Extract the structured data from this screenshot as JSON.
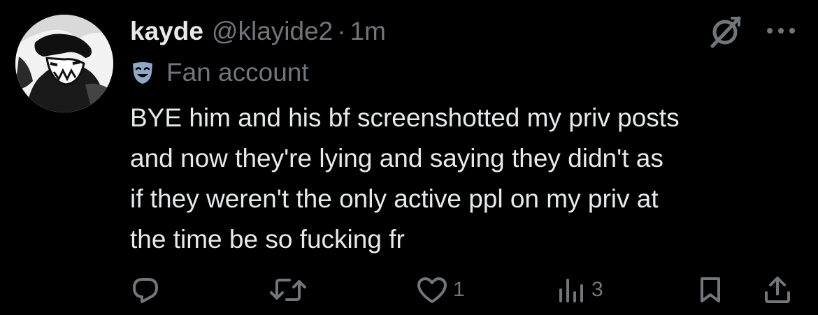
{
  "tweet": {
    "display_name": "kayde",
    "handle": "@klayide2",
    "separator": "·",
    "time": "1m",
    "label": "Fan account",
    "label_icon": "theater-mask-icon",
    "body_lines": [
      "BYE him and his bf screenshotted my priv posts",
      "and now they're lying and saying they didn't as",
      "if they weren't the only active ppl on my priv at",
      "the time be so fucking fr"
    ]
  },
  "actions": {
    "reply_count": "",
    "retweet_count": "",
    "like_count": "1",
    "view_count": "3"
  },
  "colors": {
    "background": "#000000",
    "primary_text": "#e7e9ea",
    "secondary_text": "#71767b",
    "badge_icon": "#8fa8c8"
  },
  "icons": {
    "grok": "grok-icon",
    "more": "more-icon",
    "reply": "reply-icon",
    "retweet": "retweet-icon",
    "like": "heart-icon",
    "views": "views-icon",
    "bookmark": "bookmark-icon",
    "share": "share-icon"
  }
}
